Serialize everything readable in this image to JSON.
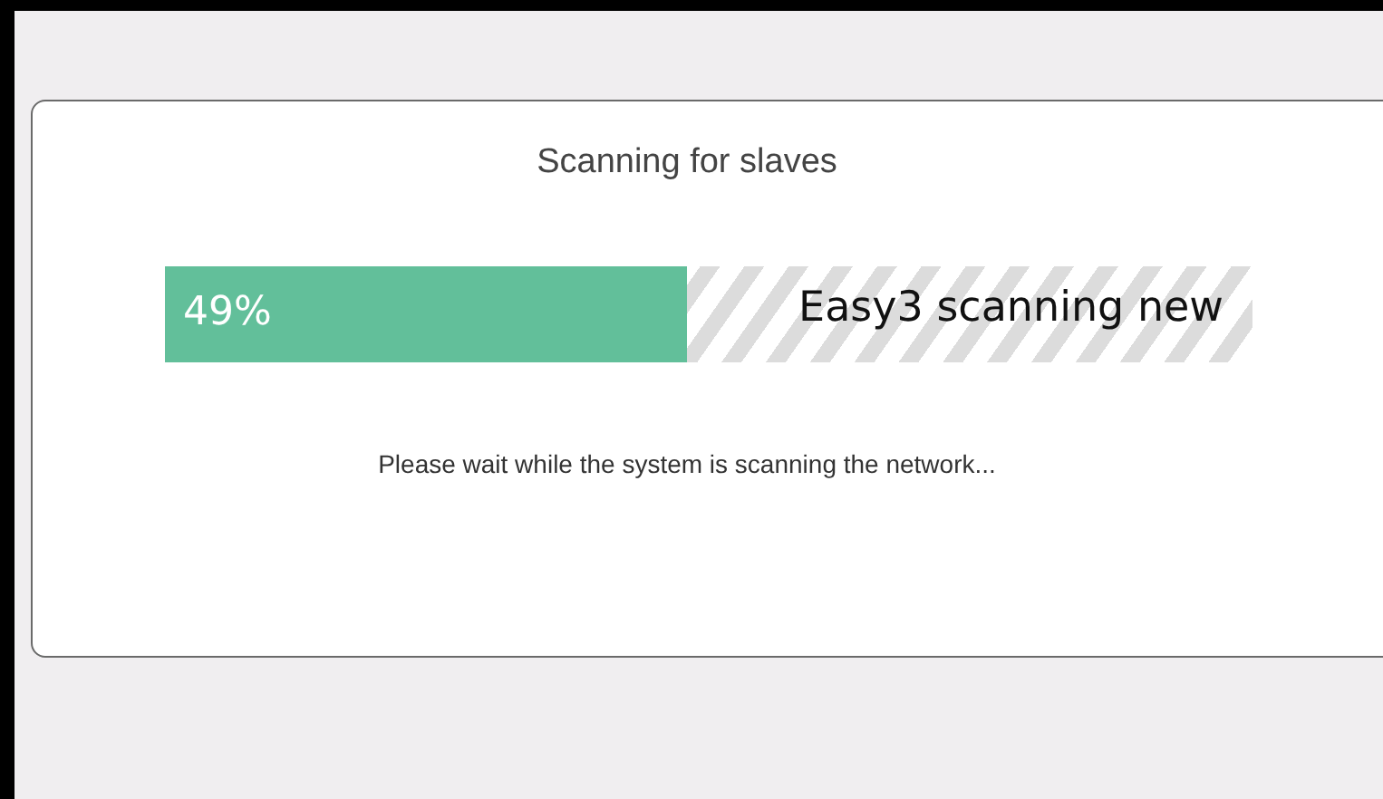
{
  "dialog": {
    "title": "Scanning for slaves",
    "progress": {
      "level": 0.48,
      "percent": "49%",
      "status": "Easy3 scanning new"
    },
    "message": "Please wait while the system is scanning the network..."
  }
}
